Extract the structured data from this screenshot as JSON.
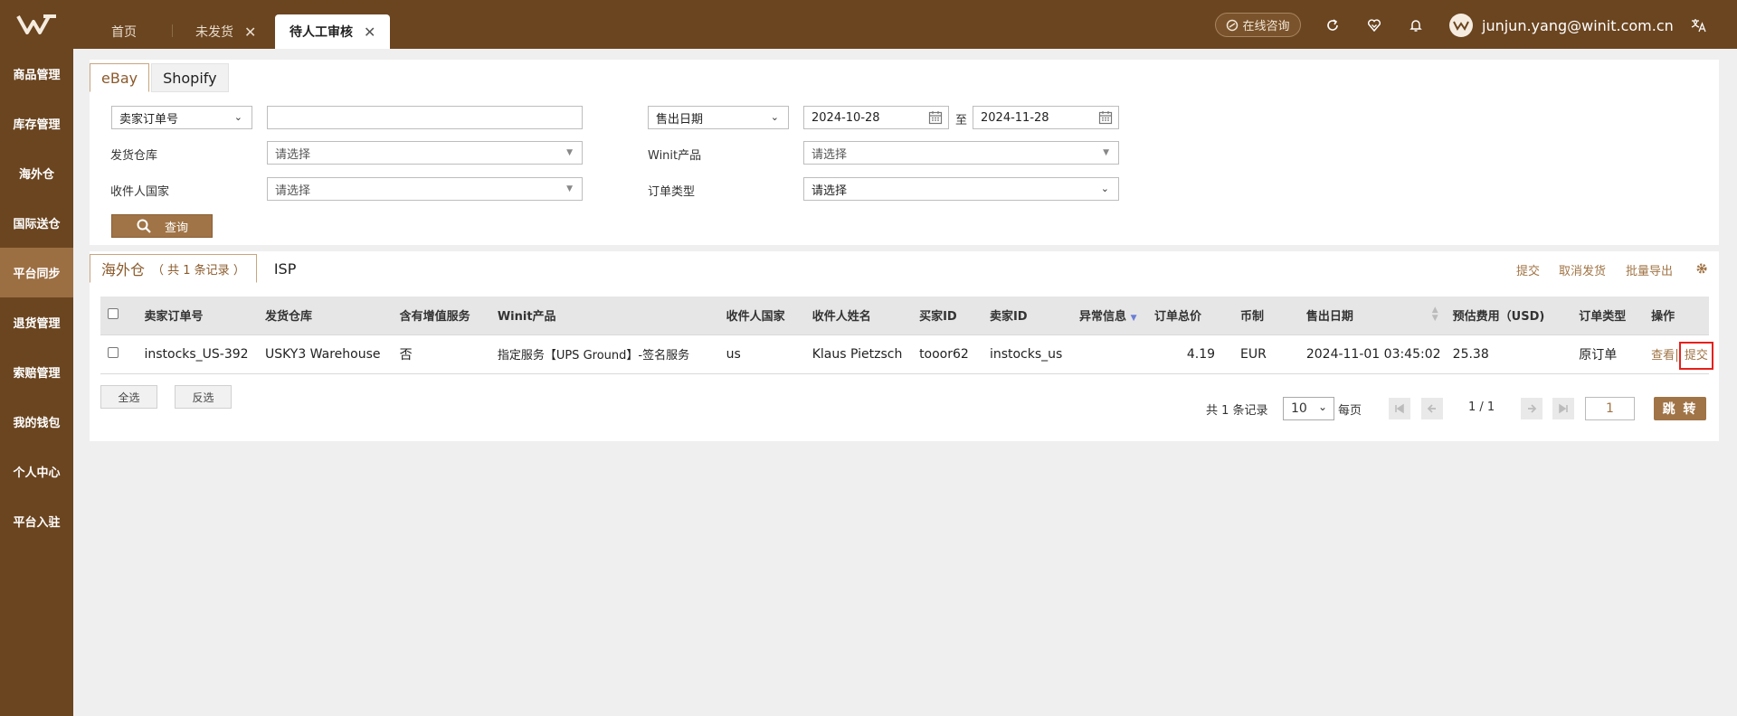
{
  "topbar": {
    "tabs": [
      {
        "label": "首页"
      },
      {
        "label": "未发货"
      },
      {
        "label": "待人工审核"
      }
    ],
    "close_glyph": "✕",
    "consult_label": "在线咨询",
    "user_email": "junjun.yang@winit.com.cn",
    "icons": [
      "refresh-icon",
      "favorite-icon",
      "bell-icon",
      "translate-icon"
    ]
  },
  "sidebar": {
    "items": [
      {
        "label": "商品管理"
      },
      {
        "label": "库存管理"
      },
      {
        "label": "海外仓"
      },
      {
        "label": "国际送仓"
      },
      {
        "label": "平台同步"
      },
      {
        "label": "退货管理"
      },
      {
        "label": "索赔管理"
      },
      {
        "label": "我的钱包"
      },
      {
        "label": "个人中心"
      },
      {
        "label": "平台入驻"
      }
    ],
    "active_index": 4
  },
  "filters": {
    "platform_tabs": [
      "eBay",
      "Shopify"
    ],
    "order_field_select": "卖家订单号",
    "order_field_value": "",
    "date_type_select": "售出日期",
    "date_from": "2024-10-28",
    "date_sep": "至",
    "date_to": "2024-11-28",
    "warehouse_label": "发货仓库",
    "warehouse_placeholder": "请选择",
    "winit_product_label": "Winit产品",
    "winit_product_placeholder": "请选择",
    "country_label": "收件人国家",
    "country_placeholder": "请选择",
    "order_type_label": "订单类型",
    "order_type_value": "请选择",
    "query_label": "查询"
  },
  "results": {
    "tabs": [
      {
        "label": "海外仓",
        "count": "（ 共 1 条记录 ）"
      },
      {
        "label": "ISP"
      }
    ],
    "actions": [
      "提交",
      "取消发货",
      "批量导出"
    ],
    "columns": [
      "卖家订单号",
      "发货仓库",
      "含有增值服务",
      "Winit产品",
      "收件人国家",
      "收件人姓名",
      "买家ID",
      "卖家ID",
      "异常信息",
      "订单总价",
      "币制",
      "售出日期",
      "预估费用（USD)",
      "订单类型",
      "操作"
    ],
    "rows": [
      {
        "seller_order_no": "instocks_US-392",
        "warehouse": "USKY3 Warehouse",
        "value_added": "否",
        "winit_product": "指定服务【UPS Ground】-签名服务",
        "country": "us",
        "recipient": "Klaus Pietzsch",
        "buyer_id": "tooor62",
        "seller_id": "instocks_us",
        "exception": "",
        "total": "4.19",
        "currency": "EUR",
        "sold_date": "2024-11-01 03:45:02",
        "est_fee": "25.38",
        "order_type": "原订单",
        "op_view": "查看",
        "op_sep": "|",
        "op_submit": "提交"
      }
    ],
    "select_all": "全选",
    "invert_select": "反选",
    "pager": {
      "total_text": "共 1 条记录",
      "page_size": "10",
      "per_page": "每页",
      "page_info": "1 / 1",
      "jump_value": "1",
      "jump_label": "跳 转"
    }
  },
  "colors": {
    "brand_brown": "#6b4520",
    "active_sidebar": "#9c6f43",
    "accent": "#a07446",
    "highlight_red": "#e5211c"
  }
}
